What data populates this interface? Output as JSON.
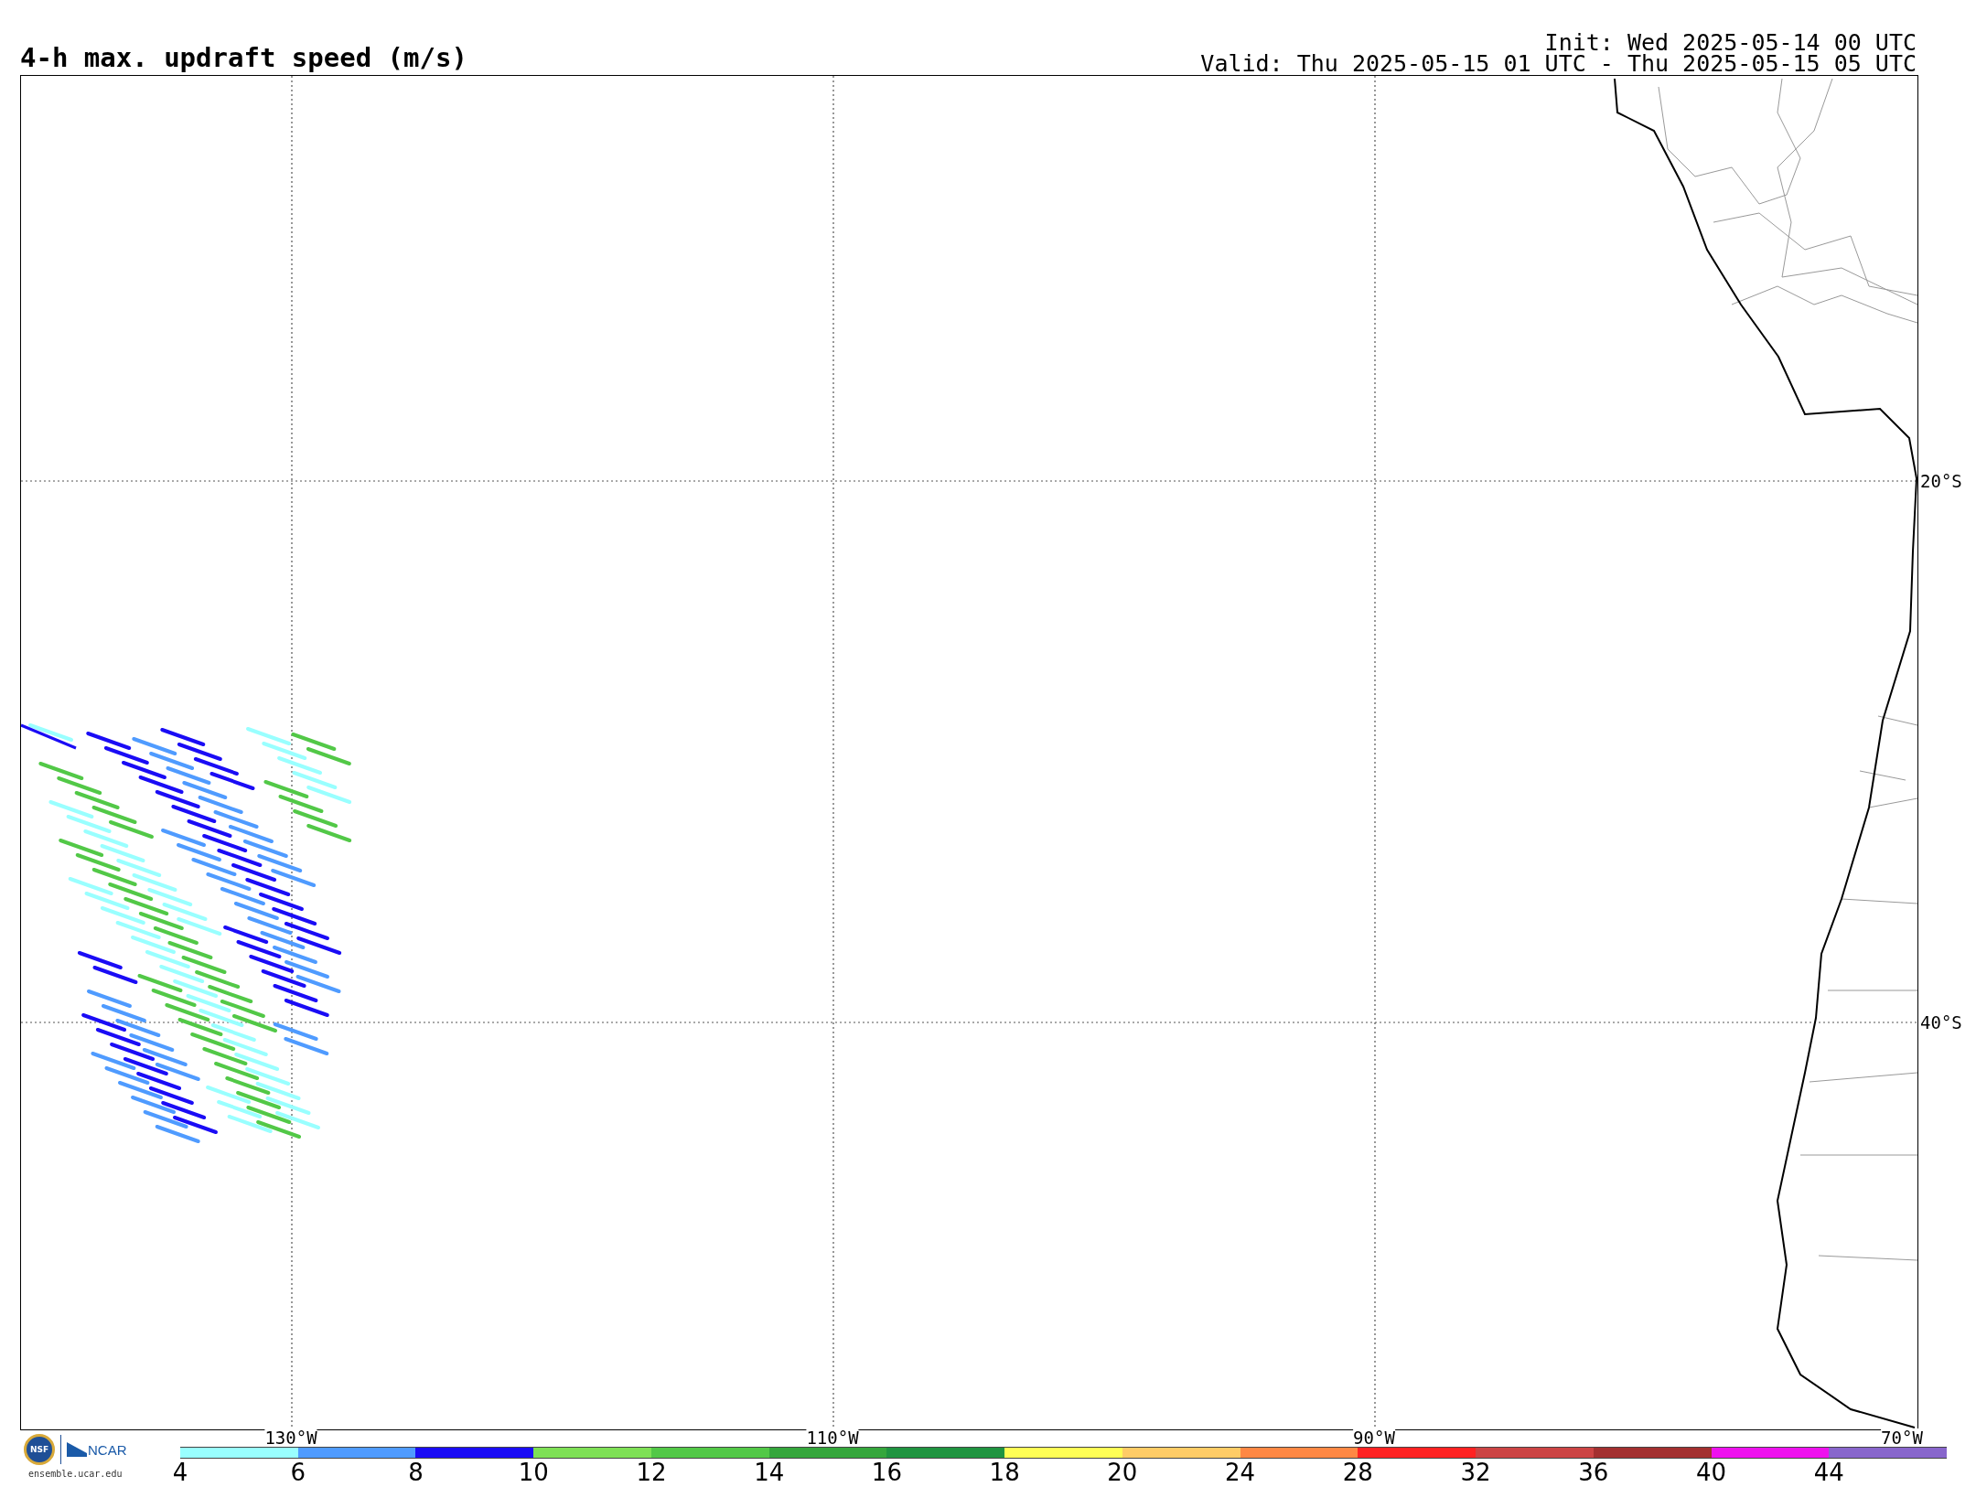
{
  "title": "4-h max. updraft speed (m/s)",
  "init": "Init: Wed 2025-05-14 00 UTC",
  "valid": "Valid: Thu 2025-05-15 01 UTC - Thu 2025-05-15 05 UTC",
  "latitude_labels": [
    "20°S",
    "40°S"
  ],
  "longitude_labels": [
    "130°W",
    "110°W",
    "90°W",
    "70°W"
  ],
  "logos": {
    "nsf": "NSF",
    "ncar": "NCAR",
    "website": "ensemble.ucar.edu"
  },
  "colorbar": [
    {
      "label": "4",
      "color": "#99ffff"
    },
    {
      "label": "6",
      "color": "#4f9bff"
    },
    {
      "label": "8",
      "color": "#1a0cf5"
    },
    {
      "label": "10",
      "color": "#7ee055"
    },
    {
      "label": "12",
      "color": "#52c847"
    },
    {
      "label": "14",
      "color": "#35a63c"
    },
    {
      "label": "16",
      "color": "#1f9440"
    },
    {
      "label": "18",
      "color": "#ffff55"
    },
    {
      "label": "20",
      "color": "#ffcc66"
    },
    {
      "label": "24",
      "color": "#ff8844"
    },
    {
      "label": "28",
      "color": "#ff2222"
    },
    {
      "label": "32",
      "color": "#cc4444"
    },
    {
      "label": "36",
      "color": "#a33030"
    },
    {
      "label": "40",
      "color": "#ee11ee"
    },
    {
      "label": "44",
      "color": "#8866cc"
    }
  ]
}
